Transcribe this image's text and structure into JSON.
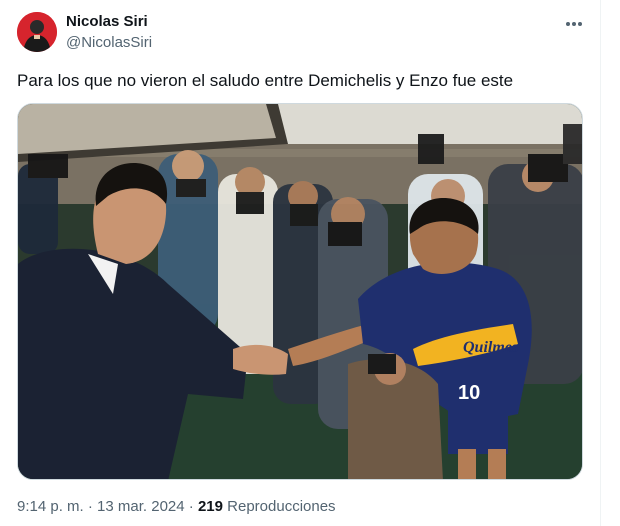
{
  "author": {
    "display_name": "Nicolas Siri",
    "handle": "@NicolasSiri",
    "avatar_icon": "profile-photo"
  },
  "more_icon": "more-dots-icon",
  "tweet": {
    "text": "Para los que no vieron el saludo entre Demichelis y Enzo fue este"
  },
  "media": {
    "jersey_sponsor": "Quilmes",
    "jersey_number": "10",
    "colors": {
      "jersey_blue": "#1f2f6e",
      "jersey_gold": "#f2b321",
      "suit": "#1b2233"
    }
  },
  "meta": {
    "time": "9:14 p. m.",
    "separator": "·",
    "date": "13 mar. 2024",
    "views_count": "219",
    "views_label": "Reproducciones"
  }
}
